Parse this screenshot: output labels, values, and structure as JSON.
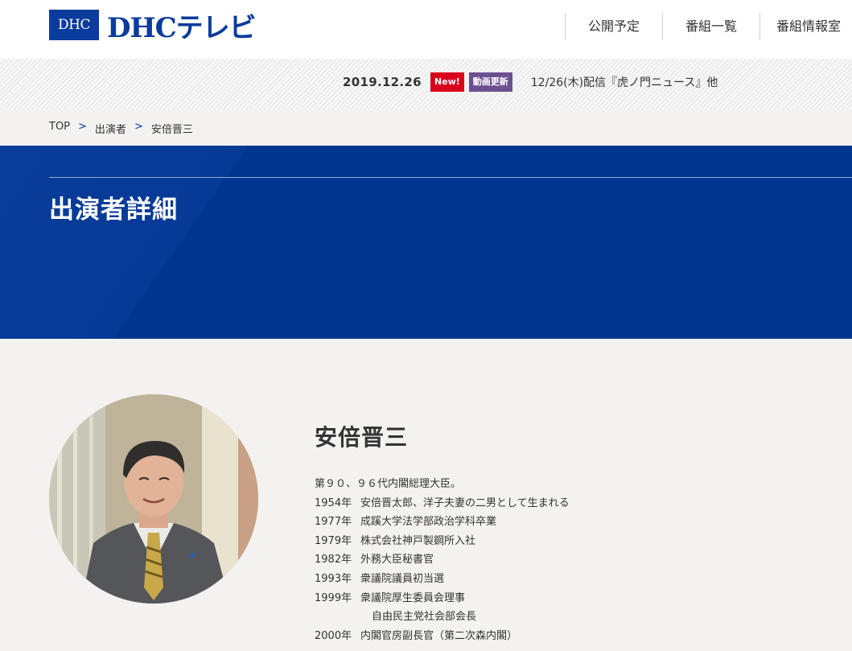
{
  "header": {
    "logo_box": "DHC",
    "logo_text": "DHCテレビ",
    "nav": [
      "公開予定",
      "番組一覧",
      "番組情報室"
    ]
  },
  "news": {
    "date": "2019.12.26",
    "badge_new": "New!",
    "badge_update": "動画更新",
    "text": "12/26(木)配信『虎ノ門ニュース』他"
  },
  "breadcrumb": {
    "items": [
      "TOP",
      "出演者",
      "安倍晋三"
    ],
    "separator": ">"
  },
  "hero": {
    "title": "出演者詳細"
  },
  "profile": {
    "name": "安倍晋三",
    "intro": "第９０、９６代内閣総理大臣。",
    "bio": [
      {
        "year": "1954年",
        "text": "安倍晋太郎、洋子夫妻の二男として生まれる"
      },
      {
        "year": "1977年",
        "text": "成蹊大学法学部政治学科卒業"
      },
      {
        "year": "1979年",
        "text": "株式会社神戸製鋼所入社"
      },
      {
        "year": "1982年",
        "text": "外務大臣秘書官"
      },
      {
        "year": "1993年",
        "text": "衆議院議員初当選"
      },
      {
        "year": "1999年",
        "text": "衆議院厚生委員会理事"
      },
      {
        "year": "",
        "text": "自由民主党社会部会長"
      },
      {
        "year": "2000年",
        "text": "内閣官房副長官（第二次森内閣）"
      }
    ]
  },
  "colors": {
    "brand_blue": "#0b3b9c",
    "hero_blue": "#003690",
    "badge_new": "#d8001c",
    "badge_update": "#6b4f8f"
  }
}
